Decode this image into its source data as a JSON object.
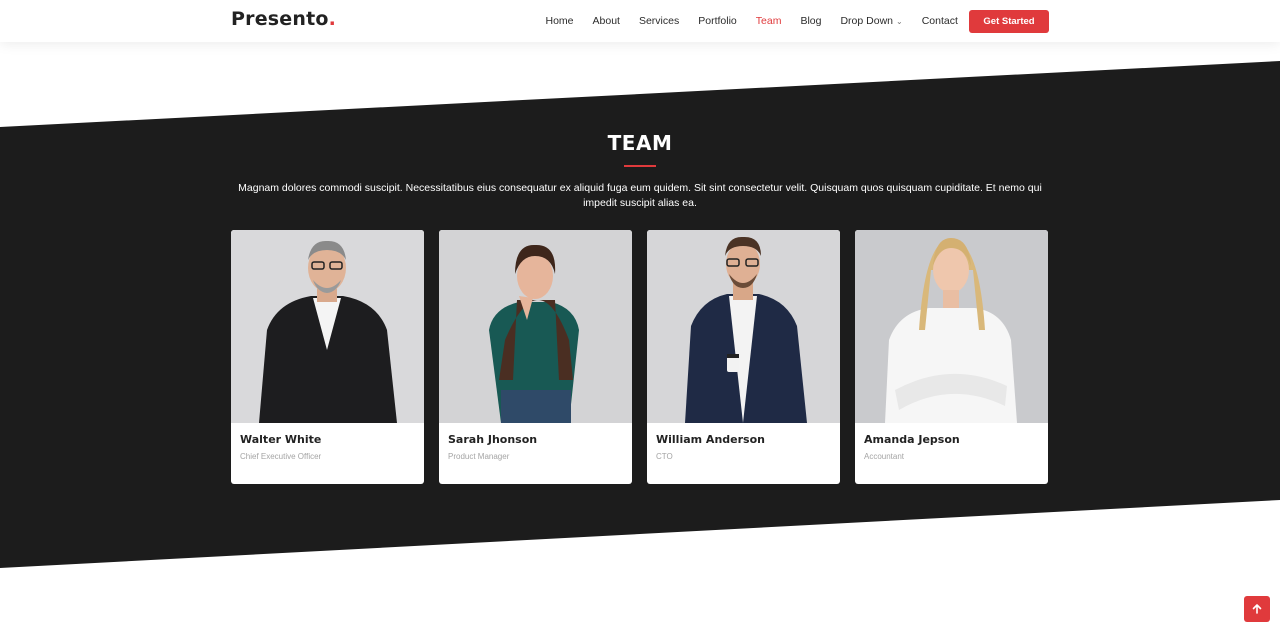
{
  "header": {
    "logo_text": "Presento",
    "logo_dot": ".",
    "nav": [
      {
        "label": "Home"
      },
      {
        "label": "About"
      },
      {
        "label": "Services"
      },
      {
        "label": "Portfolio"
      },
      {
        "label": "Team",
        "active": true
      },
      {
        "label": "Blog"
      },
      {
        "label": "Drop Down"
      },
      {
        "label": "Contact"
      }
    ],
    "cta_label": "Get Started"
  },
  "team": {
    "title": "TEAM",
    "description": "Magnam dolores commodi suscipit. Necessitatibus eius consequatur ex aliquid fuga eum quidem. Sit sint consectetur velit. Quisquam quos quisquam cupiditate. Et nemo qui impedit suscipit alias ea.",
    "members": [
      {
        "name": "Walter White",
        "role": "Chief Executive Officer"
      },
      {
        "name": "Sarah Jhonson",
        "role": "Product Manager"
      },
      {
        "name": "William Anderson",
        "role": "CTO"
      },
      {
        "name": "Amanda Jepson",
        "role": "Accountant"
      }
    ]
  },
  "colors": {
    "accent": "#e03a3c",
    "band": "#1c1c1c"
  },
  "icons": {
    "scroll_top": "arrow-up-icon",
    "dropdown": "chevron-down-icon"
  }
}
